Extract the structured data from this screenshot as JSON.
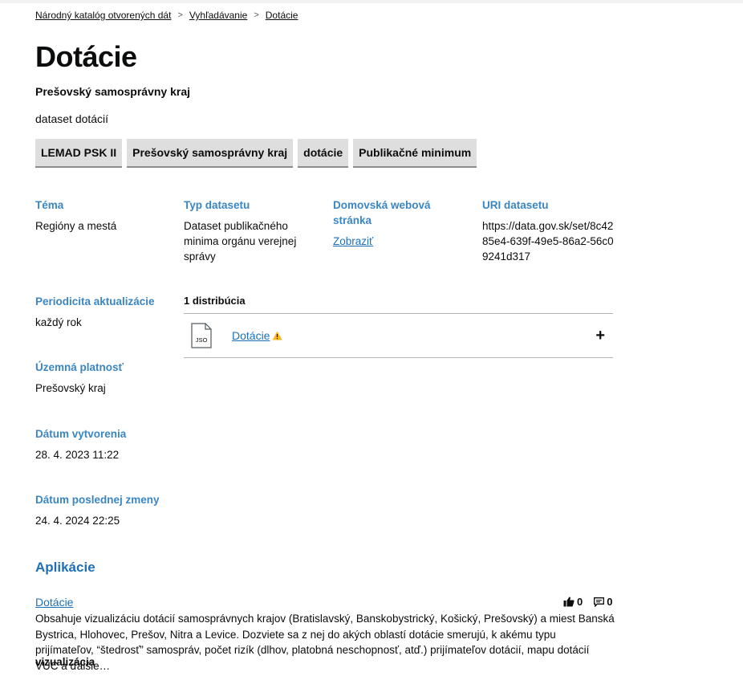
{
  "breadcrumb": {
    "items": [
      "Národný katalóg otvorených dát",
      "Vyhľadávanie",
      "Dotácie"
    ]
  },
  "dataset": {
    "title": "Dotácie",
    "publisher": "Prešovský samosprávny kraj",
    "description": "dataset dotácií",
    "tags": [
      "LEMAD PSK II",
      "Prešovský samosprávny kraj",
      "dotácie",
      "Publikačné minimum"
    ]
  },
  "meta": {
    "theme": {
      "label": "Téma",
      "value": "Regióny a mestá"
    },
    "type": {
      "label": "Typ datasetu",
      "value": "Dataset publikačného minima orgánu verejnej správy"
    },
    "homepage": {
      "label": "Domovská webová stránka",
      "link": "Zobraziť"
    },
    "uri": {
      "label": "URI datasetu",
      "value": "https://data.gov.sk/set/8c4285e4-639f-49e5-86a2-56c09241d317"
    },
    "periodicity": {
      "label": "Periodicita aktualizácie",
      "value": "každý rok"
    },
    "spatial": {
      "label": "Územná platnosť",
      "value": "Prešovský kraj"
    },
    "created": {
      "label": "Dátum vytvorenia",
      "value": "28. 4. 2023 11:22"
    },
    "modified": {
      "label": "Dátum poslednej zmeny",
      "value": "24. 4. 2024 22:25"
    }
  },
  "distributions": {
    "count_label": "1 distribúcia",
    "items": [
      {
        "format": "JSO",
        "name": "Dotácie",
        "icon": "warning-icon",
        "toggle": "+"
      }
    ]
  },
  "applications": {
    "title": "Aplikácie",
    "items": [
      {
        "name": "Dotácie",
        "likes": "0",
        "comments": "0",
        "description": "Obsahuje vizualizáciu dotácií samosprávnych krajov (Bratislavský, Banskobystrický, Košický, Prešovský) a miest Banská Bystrica, Hlohovec, Prešov, Nitra a Levice. Dozviete sa z nej do akých oblastí dotácie smerujú, k akému typu prijímateľov, “štedrosť” samospráv, počet rizík (dlhov, platobná neschopnosť, atď.) prijímateľov dotácií, mapu dotácií VÚC a ďalšie…",
        "type": "vizualizácia"
      }
    ]
  },
  "colors": {
    "label_blue": "#3a86c4",
    "link_blue": "#1d70b8",
    "tag_bg": "#dedede",
    "warning": "#ffb81c"
  }
}
